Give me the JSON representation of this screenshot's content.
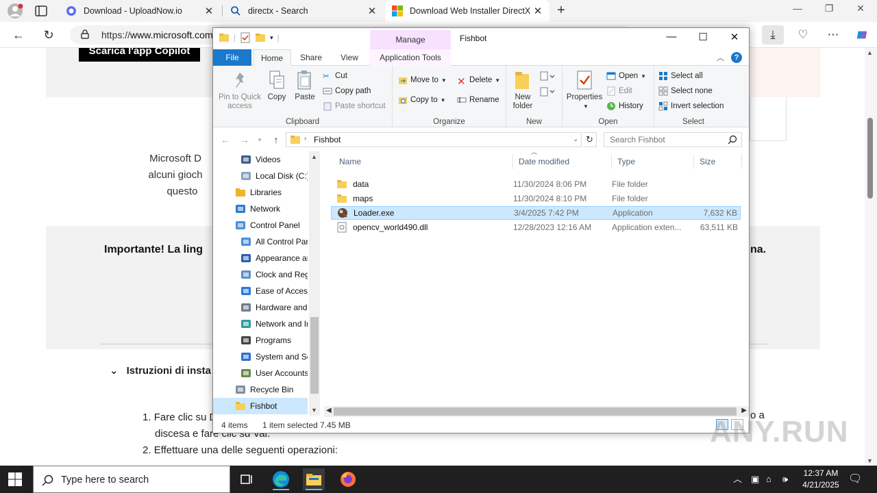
{
  "browser": {
    "tabs": [
      {
        "title": "Download - UploadNow.io",
        "icon": "uploadnow-icon"
      },
      {
        "title": "directx - Search",
        "icon": "search-icon"
      },
      {
        "title": "Download Web Installer DirectX E",
        "icon": "microsoft-logo-icon",
        "active": true
      }
    ],
    "url_prefix": "https://",
    "url_domain": "www.microsoft.com"
  },
  "page": {
    "copilot_button": "Scarica l'app Copilot",
    "para_lines": [
      "Microsoft D",
      "alcuni gioch",
      "questo"
    ],
    "important": "Importante! La ling",
    "important_end": "na.",
    "instructions_heading": "Istruzioni di insta",
    "steps": [
      {
        "num": "1.",
        "text": "Fare clic su D",
        "cont": "discesa e fare clic su Vai."
      },
      {
        "num": "2.",
        "text": "Effettuare una delle seguenti operazioni:"
      }
    ],
    "step1_end": "o a"
  },
  "explorer": {
    "title": "Fishbot",
    "manage_label": "Manage",
    "ribbon_tabs": [
      "File",
      "Home",
      "Share",
      "View",
      "Application Tools"
    ],
    "clipboard": {
      "group": "Clipboard",
      "pin": "Pin to Quick access",
      "copy": "Copy",
      "paste": "Paste",
      "cut": "Cut",
      "copy_path": "Copy path",
      "paste_shortcut": "Paste shortcut"
    },
    "organize": {
      "group": "Organize",
      "move_to": "Move to",
      "copy_to": "Copy to",
      "delete": "Delete",
      "rename": "Rename"
    },
    "new": {
      "group": "New",
      "new_folder": "New folder"
    },
    "open": {
      "group": "Open",
      "properties": "Properties",
      "open": "Open",
      "edit": "Edit",
      "history": "History"
    },
    "select": {
      "group": "Select",
      "select_all": "Select all",
      "select_none": "Select none",
      "invert": "Invert selection"
    },
    "path": "Fishbot",
    "search_placeholder": "Search Fishbot",
    "nav_items": [
      {
        "label": "Videos",
        "icon": "videos-icon",
        "indent": 1
      },
      {
        "label": "Local Disk (C:)",
        "icon": "drive-icon",
        "indent": 1
      },
      {
        "label": "Libraries",
        "icon": "libraries-icon",
        "indent": 0
      },
      {
        "label": "Network",
        "icon": "network-icon",
        "indent": 0
      },
      {
        "label": "Control Panel",
        "icon": "control-panel-icon",
        "indent": 0
      },
      {
        "label": "All Control Par",
        "icon": "control-panel-icon",
        "indent": 1
      },
      {
        "label": "Appearance an",
        "icon": "appearance-icon",
        "indent": 1
      },
      {
        "label": "Clock and Regi",
        "icon": "clock-icon",
        "indent": 1
      },
      {
        "label": "Ease of Access",
        "icon": "ease-of-access-icon",
        "indent": 1
      },
      {
        "label": "Hardware and",
        "icon": "hardware-icon",
        "indent": 1
      },
      {
        "label": "Network and Ir",
        "icon": "network-internet-icon",
        "indent": 1
      },
      {
        "label": "Programs",
        "icon": "programs-icon",
        "indent": 1
      },
      {
        "label": "System and Se",
        "icon": "system-security-icon",
        "indent": 1
      },
      {
        "label": "User Accounts",
        "icon": "user-accounts-icon",
        "indent": 1
      },
      {
        "label": "Recycle Bin",
        "icon": "recycle-bin-icon",
        "indent": 0
      },
      {
        "label": "Fishbot",
        "icon": "folder-icon",
        "indent": 0,
        "selected": true
      }
    ],
    "columns": [
      "Name",
      "Date modified",
      "Type",
      "Size"
    ],
    "files": [
      {
        "name": "data",
        "date": "11/30/2024 8:06 PM",
        "type": "File folder",
        "size": "",
        "icon": "folder-icon"
      },
      {
        "name": "maps",
        "date": "11/30/2024 8:10 PM",
        "type": "File folder",
        "size": "",
        "icon": "folder-icon"
      },
      {
        "name": "Loader.exe",
        "date": "3/4/2025 7:42 PM",
        "type": "Application",
        "size": "7,632 KB",
        "icon": "exe-icon",
        "selected": true
      },
      {
        "name": "opencv_world490.dll",
        "date": "12/28/2023 12:16 AM",
        "type": "Application exten...",
        "size": "63,511 KB",
        "icon": "dll-icon"
      }
    ],
    "status_count": "4 items",
    "status_selected": "1 item selected  7.45 MB"
  },
  "watermark": "ANY.RUN",
  "taskbar": {
    "search_placeholder": "Type here to search",
    "time": "12:37 AM",
    "date": "4/21/2025"
  },
  "colors": {
    "accent": "#1979ca",
    "selection": "#cce8ff",
    "manage_tab": "#f7e1ff",
    "taskbar": "#1f1f1f"
  }
}
